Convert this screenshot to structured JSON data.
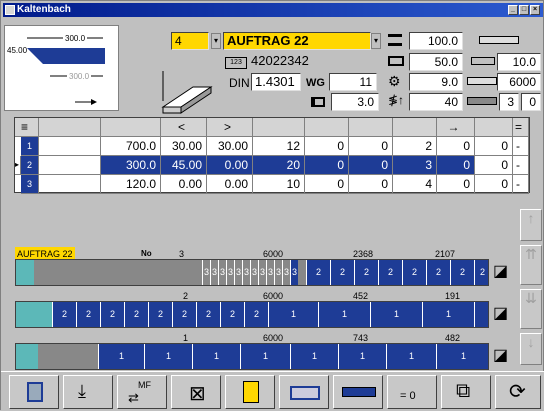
{
  "window": {
    "title": "Kaltenbach"
  },
  "profile": {
    "dim_top": "300.0",
    "angle": "45.00",
    "dim_bottom": "300.0"
  },
  "header": {
    "pos_value": "4",
    "order_name": "AUFTRAG 22",
    "article": "42022342",
    "din_label": "DIN",
    "material": "1.4301",
    "wg_label": "WG",
    "wg_value": "11",
    "right_vals": [
      "100.0",
      "50.0",
      "9.0",
      "40"
    ],
    "far_vals": [
      "10.0",
      "6000",
      "3",
      "0"
    ],
    "bottom_val": "3.0"
  },
  "table": {
    "rows": [
      {
        "num": "1",
        "len": "700.0",
        "a1": "30.00",
        "a2": "30.00",
        "qty": "12",
        "c5": "0",
        "c6": "0",
        "c7": "2",
        "c8": "0",
        "c9": "0",
        "c10": "-"
      },
      {
        "num": "2",
        "len": "300.0",
        "a1": "45.00",
        "a2": "0.00",
        "qty": "20",
        "c5": "0",
        "c6": "0",
        "c7": "3",
        "c8": "0",
        "c9": "0",
        "c10": "-"
      },
      {
        "num": "3",
        "len": "120.0",
        "a1": "0.00",
        "a2": "0.00",
        "qty": "10",
        "c5": "0",
        "c6": "0",
        "c7": "4",
        "c8": "0",
        "c9": "0",
        "c10": "-"
      }
    ]
  },
  "bars": {
    "order_label": "AUFTRAG 22",
    "no_label": "No",
    "no_value": "3",
    "bar1_len": "6000",
    "bar1_rest": "2368",
    "bar1_rest2": "2107",
    "bar2_a": "2",
    "bar2_len": "6000",
    "bar2_rest": "452",
    "bar2_rest2": "191",
    "bar3_a": "1",
    "bar3_len": "6000",
    "bar3_rest": "743",
    "bar3_rest2": "482",
    "seg3": "3",
    "seg2": "2",
    "seg1": "1"
  },
  "toolbar": {
    "btn_mf": "MF",
    "btn_eq0": "= 0"
  }
}
